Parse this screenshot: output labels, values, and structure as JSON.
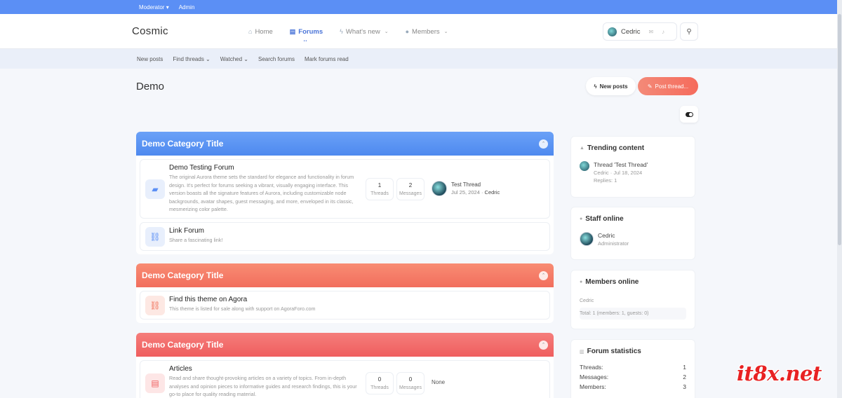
{
  "staffbar": {
    "moderator": "Moderator",
    "admin": "Admin"
  },
  "header": {
    "logo": "Cosmic",
    "nav": [
      {
        "label": "Home"
      },
      {
        "label": "Forums"
      },
      {
        "label": "What's new"
      },
      {
        "label": "Members"
      }
    ],
    "user": "Cedric"
  },
  "subnav": {
    "new_posts": "New posts",
    "find_threads": "Find threads",
    "watched": "Watched",
    "search_forums": "Search forums",
    "mark_read": "Mark forums read"
  },
  "page": {
    "title": "Demo",
    "new_posts_btn": "New posts",
    "post_thread_btn": "Post thread..."
  },
  "categories": [
    {
      "title": "Demo Category Title",
      "color": "#5b93f3",
      "nodes": [
        {
          "title": "Demo Testing Forum",
          "desc": "The original Aurora theme sets the standard for elegance and functionality in forum design. It's perfect for forums seeking a vibrant, visually engaging interface. This version boasts all the signature features of Aurora, including customizable node backgrounds, avatar shapes, guest messaging, and more, enveloped in its classic, mesmerizing color palette.",
          "threads": "1",
          "threads_label": "Threads",
          "messages": "2",
          "messages_label": "Messages",
          "last_title": "Test Thread",
          "last_date": "Jul 25, 2024",
          "last_user": "Cedric"
        },
        {
          "title": "Link Forum",
          "desc": "Share a fascinating link!"
        }
      ]
    },
    {
      "title": "Demo Category Title",
      "color": "#f4775f",
      "nodes": [
        {
          "title": "Find this theme on Agora",
          "desc": "This theme is listed for sale along with support on AgoraForo.com"
        }
      ]
    },
    {
      "title": "Demo Category Title",
      "color": "#f06565",
      "nodes": [
        {
          "title": "Articles",
          "desc": "Read and share thought-provoking articles on a variety of topics. From in-depth analyses and opinion pieces to informative guides and research findings, this is your go-to place for quality reading material.",
          "threads": "0",
          "threads_label": "Threads",
          "messages": "0",
          "messages_label": "Messages",
          "none": "None"
        }
      ]
    }
  ],
  "sidebar": {
    "trending": {
      "title": "Trending content",
      "thread": "Thread 'Test Thread'",
      "meta": "Cedric · Jul 18, 2024",
      "replies": "Replies: 1"
    },
    "staff": {
      "title": "Staff online",
      "name": "Cedric",
      "role": "Administrator"
    },
    "members": {
      "title": "Members online",
      "name": "Cedric",
      "total": "Total: 1 (members: 1, guests: 0)"
    },
    "stats": {
      "title": "Forum statistics",
      "rows": [
        {
          "label": "Threads:",
          "value": "1"
        },
        {
          "label": "Messages:",
          "value": "2"
        },
        {
          "label": "Members:",
          "value": "3"
        }
      ]
    }
  },
  "watermark": "it8x.net"
}
